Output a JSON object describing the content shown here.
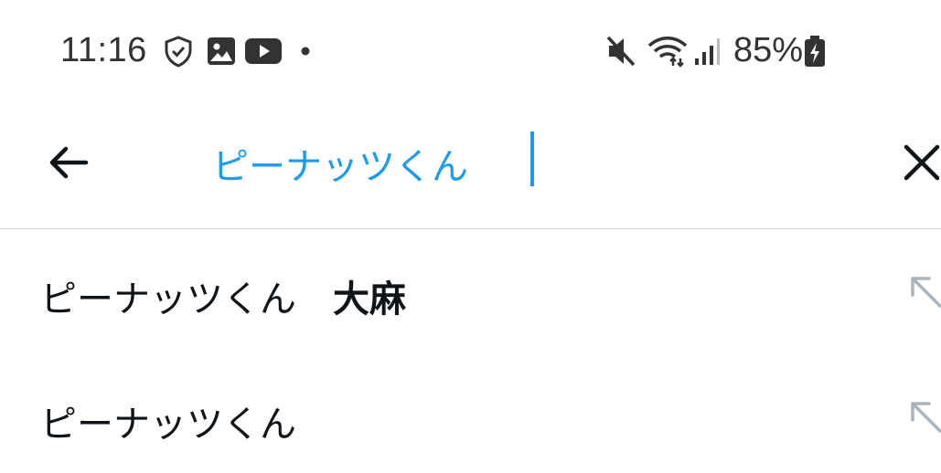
{
  "status_bar": {
    "time": "11:16",
    "battery": "85%",
    "icons": [
      "shield-check-icon",
      "image-icon",
      "youtube-icon",
      "dot-icon",
      "mute-icon",
      "wifi-icon",
      "signal-icon",
      "battery-charging-icon"
    ]
  },
  "search": {
    "query": "ピーナッツくん",
    "accent_color": "#1d9bf0"
  },
  "suggestions": [
    {
      "prefix": "ピーナッツくん",
      "suffix": "大麻"
    },
    {
      "prefix": "ピーナッツくん",
      "suffix": ""
    }
  ]
}
